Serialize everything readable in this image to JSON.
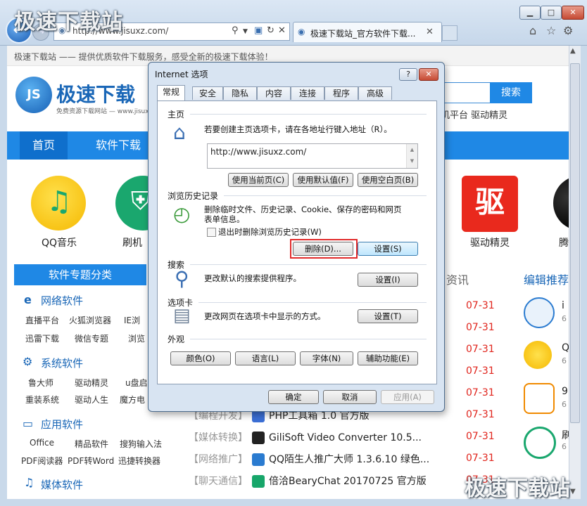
{
  "browser": {
    "watermark": "极速下载站",
    "address": "http://www.jisuxz.com/",
    "tab_title": "极速下载站_官方软件下载...",
    "window_buttons": [
      "minimize-icon",
      "maximize-icon",
      "close-icon"
    ]
  },
  "page": {
    "tagline": "极速下载站 —— 提供优质软件下载服务，感受全新的极速下载体验！",
    "logo_text": "极速下载",
    "logo_badge": "JS",
    "logo_sub": "免费资源下载网站 — www.jisuxz",
    "search_button": "搜索",
    "hot_links": "机平台   驱动精灵",
    "nav": [
      "首页",
      "软件下载"
    ],
    "apps": [
      {
        "name": "QQ音乐"
      },
      {
        "name": "刷机"
      },
      {
        "name": "驱动精灵",
        "glyph": "驱"
      },
      {
        "name": "腾"
      }
    ],
    "category_header": "软件专题分类",
    "categories": [
      {
        "title": "网络软件",
        "links": [
          [
            "直播平台",
            "火狐浏览器",
            "IE浏"
          ],
          [
            "迅雷下载",
            "微信专题",
            "浏览"
          ]
        ]
      },
      {
        "title": "系统软件",
        "links": [
          [
            "鲁大师",
            "驱动精灵",
            "u盘启"
          ],
          [
            "重装系统",
            "驱动人生",
            "魔方电"
          ]
        ]
      },
      {
        "title": "应用软件",
        "links": [
          [
            "Office",
            "精品软件",
            "搜狗输入法"
          ],
          [
            "PDF阅读器",
            "PDF转Word",
            "迅捷转换器"
          ]
        ]
      },
      {
        "title": "媒体软件",
        "links": []
      }
    ],
    "news_header": "资讯",
    "editor_header": "编辑推荐",
    "dates": [
      "07-31",
      "07-31",
      "07-31",
      "07-31",
      "07-31",
      "07-31",
      "07-31",
      "07-31",
      "07-31"
    ],
    "news": [
      {
        "cat": "【编程开发】",
        "name": "PHP工具箱 1.0 官方版"
      },
      {
        "cat": "【媒体转换】",
        "name": "GiliSoft Video Converter 10.5..."
      },
      {
        "cat": "【网络推广】",
        "name": "QQ陌生人推广大师 1.3.6.10 绿色..."
      },
      {
        "cat": "【聊天通信】",
        "name": "倍洽BearyChat 20170725 官方版"
      }
    ],
    "side": [
      {
        "title": "i",
        "sub": "6"
      },
      {
        "title": "Q",
        "sub": "6"
      },
      {
        "title": "9",
        "sub": "6"
      },
      {
        "title": "刷",
        "sub": "6"
      }
    ],
    "colors": {
      "brand": "#1f88e5",
      "date": "#e0241c"
    }
  },
  "dialog": {
    "title": "Internet 选项",
    "help": "?",
    "close": "✕",
    "tabs": [
      "常规",
      "安全",
      "隐私",
      "内容",
      "连接",
      "程序",
      "高级"
    ],
    "homepage": {
      "label": "主页",
      "desc": "若要创建主页选项卡，请在各地址行键入地址（R）。",
      "url": "http://www.jisuxz.com/",
      "btn_current": "使用当前页(C)",
      "btn_default": "使用默认值(F)",
      "btn_blank": "使用空白页(B)"
    },
    "history": {
      "label": "浏览历史记录",
      "desc_line1": "删除临时文件、历史记录、Cookie、保存的密码和网页",
      "desc_line2": "表单信息。",
      "checkbox": "退出时删除浏览历史记录(W)",
      "btn_delete": "删除(D)...",
      "btn_settings": "设置(S)"
    },
    "search": {
      "label": "搜索",
      "desc": "更改默认的搜索提供程序。",
      "btn_settings": "设置(I)"
    },
    "tabsgroup": {
      "label": "选项卡",
      "desc": "更改网页在选项卡中显示的方式。",
      "btn_settings": "设置(T)"
    },
    "appearance": {
      "label": "外观",
      "btn_colors": "颜色(O)",
      "btn_language": "语言(L)",
      "btn_fonts": "字体(N)",
      "btn_access": "辅助功能(E)"
    },
    "footer": {
      "ok": "确定",
      "cancel": "取消",
      "apply": "应用(A)"
    }
  }
}
